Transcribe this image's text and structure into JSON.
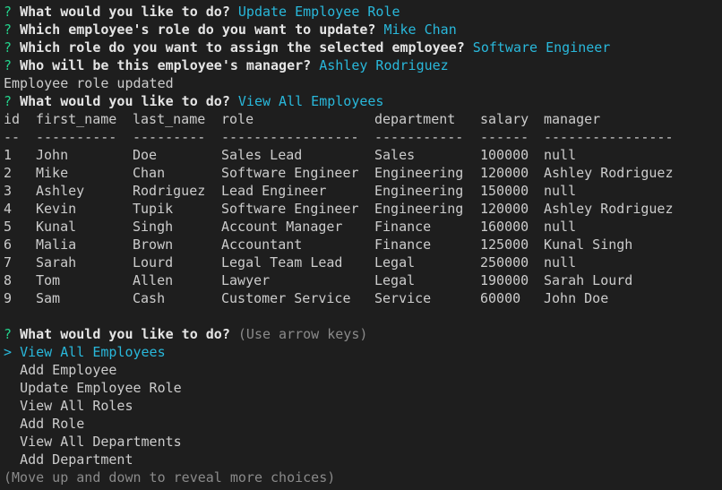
{
  "prompt_symbol": "?",
  "history": [
    {
      "question": "What would you like to do?",
      "answer": "Update Employee Role"
    },
    {
      "question": "Which employee's role do you want to update?",
      "answer": "Mike Chan"
    },
    {
      "question": "Which role do you want to assign the selected employee?",
      "answer": "Software Engineer"
    },
    {
      "question": "Who will be this employee's manager?",
      "answer": "Ashley Rodriguez"
    }
  ],
  "status_message": "Employee role updated",
  "history2": {
    "question": "What would you like to do?",
    "answer": "View All Employees"
  },
  "table": {
    "headers": [
      "id",
      "first_name",
      "last_name",
      "role",
      "department",
      "salary",
      "manager"
    ],
    "separators": [
      "--",
      "----------",
      "---------",
      "-----------------",
      "-----------",
      "------",
      "----------------"
    ],
    "rows": [
      [
        "1",
        "John",
        "Doe",
        "Sales Lead",
        "Sales",
        "100000",
        "null"
      ],
      [
        "2",
        "Mike",
        "Chan",
        "Software Engineer",
        "Engineering",
        "120000",
        "Ashley Rodriguez"
      ],
      [
        "3",
        "Ashley",
        "Rodriguez",
        "Lead Engineer",
        "Engineering",
        "150000",
        "null"
      ],
      [
        "4",
        "Kevin",
        "Tupik",
        "Software Engineer",
        "Engineering",
        "120000",
        "Ashley Rodriguez"
      ],
      [
        "5",
        "Kunal",
        "Singh",
        "Account Manager",
        "Finance",
        "160000",
        "null"
      ],
      [
        "6",
        "Malia",
        "Brown",
        "Accountant",
        "Finance",
        "125000",
        "Kunal Singh"
      ],
      [
        "7",
        "Sarah",
        "Lourd",
        "Legal Team Lead",
        "Legal",
        "250000",
        "null"
      ],
      [
        "8",
        "Tom",
        "Allen",
        "Lawyer",
        "Legal",
        "190000",
        "Sarah Lourd"
      ],
      [
        "9",
        "Sam",
        "Cash",
        "Customer Service",
        "Service",
        "60000",
        "John Doe"
      ]
    ]
  },
  "menu": {
    "question": "What would you like to do?",
    "hint": "(Use arrow keys)",
    "pointer": ">",
    "choices": [
      "View All Employees",
      "Add Employee",
      "Update Employee Role",
      "View All Roles",
      "Add Role",
      "View All Departments",
      "Add Department"
    ],
    "selected_index": 0,
    "footer": "(Move up and down to reveal more choices)"
  },
  "colors": {
    "background": "#1e1e1e",
    "prompt_symbol": "#23d18b",
    "answer": "#29b8db",
    "hint": "#8a8a8a",
    "text": "#cccccc"
  }
}
